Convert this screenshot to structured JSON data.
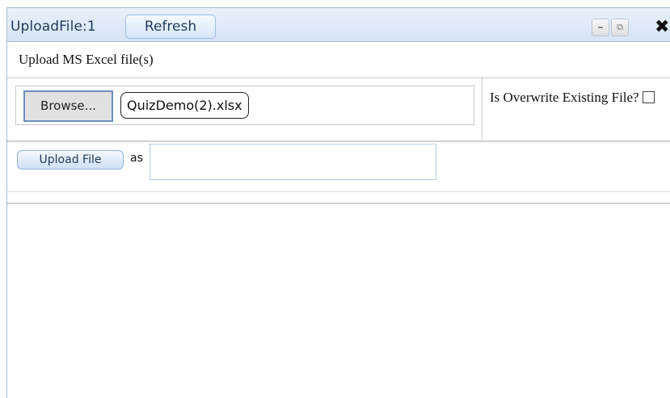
{
  "window": {
    "title": "UploadFile:1",
    "refresh_label": "Refresh",
    "minimize_glyph": "–",
    "popout_glyph": "⧉",
    "close_glyph": "✖"
  },
  "form": {
    "heading": "Upload MS Excel file(s)",
    "browse_label": "Browse...",
    "selected_file": "QuizDemo(2).xlsx",
    "overwrite_label": "Is Overwrite Existing File?",
    "overwrite_checked": false,
    "upload_label": "Upload File",
    "as_label": "as",
    "as_value": ""
  },
  "icons": [
    "minimize-icon",
    "popout-icon",
    "close-icon"
  ],
  "colors": {
    "titlebar": "#d6e4f5",
    "button_border": "#9fbde0",
    "browse_border": "#6f8fbd"
  }
}
